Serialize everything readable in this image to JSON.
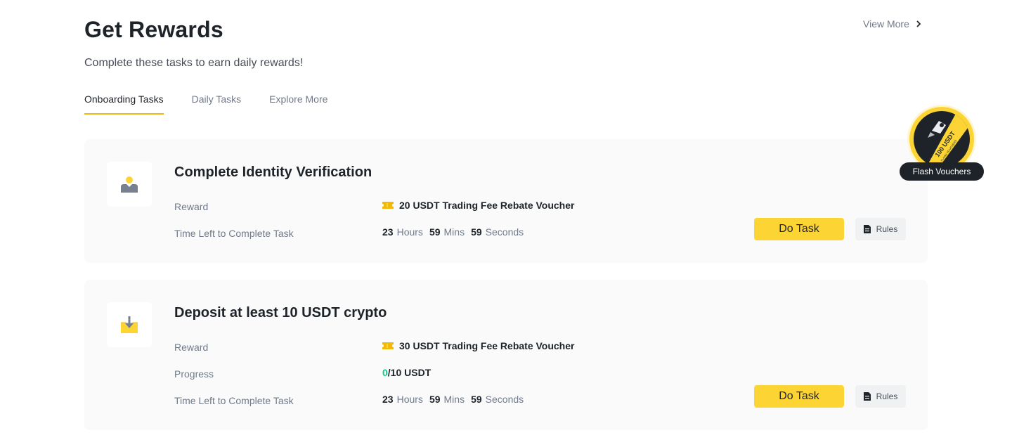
{
  "header": {
    "title": "Get Rewards",
    "subtitle": "Complete these tasks to earn daily rewards!",
    "view_more": "View More"
  },
  "tabs": [
    {
      "label": "Onboarding Tasks",
      "active": true
    },
    {
      "label": "Daily Tasks",
      "active": false
    },
    {
      "label": "Explore More",
      "active": false
    }
  ],
  "flash_vouchers": {
    "label": "Flash Vouchers",
    "badge_text": "100 USDT",
    "badge_subtext": "FLASH VOUCHERS"
  },
  "tasks": [
    {
      "title": "Complete Identity Verification",
      "icon": "user-id-icon",
      "reward_label": "Reward",
      "reward_value": "20 USDT Trading Fee Rebate Voucher",
      "time_label": "Time Left to Complete Task",
      "time": {
        "hours": "23",
        "hours_unit": "Hours",
        "mins": "59",
        "mins_unit": "Mins",
        "secs": "59",
        "secs_unit": "Seconds"
      },
      "do_task": "Do Task",
      "rules": "Rules"
    },
    {
      "title": "Deposit at least 10 USDT crypto",
      "icon": "deposit-icon",
      "reward_label": "Reward",
      "reward_value": "30 USDT Trading Fee Rebate Voucher",
      "progress_label": "Progress",
      "progress_current": "0",
      "progress_rest": "/10 USDT",
      "time_label": "Time Left to Complete Task",
      "time": {
        "hours": "23",
        "hours_unit": "Hours",
        "mins": "59",
        "mins_unit": "Mins",
        "secs": "59",
        "secs_unit": "Seconds"
      },
      "do_task": "Do Task",
      "rules": "Rules"
    }
  ],
  "colors": {
    "accent": "#fcd535",
    "tab_underline": "#f0b90b",
    "progress_green": "#0ecb81",
    "card_bg": "#fafafa"
  }
}
